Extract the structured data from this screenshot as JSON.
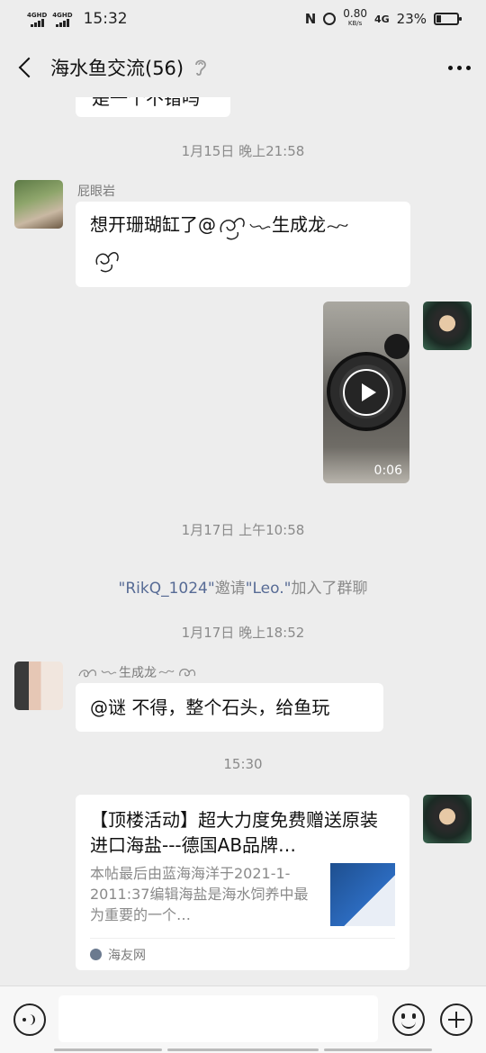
{
  "status_bar": {
    "signal1": "4GHD",
    "signal2": "4GHD",
    "time": "15:32",
    "nfc": "N",
    "speed_value": "0.80",
    "speed_unit": "KB/s",
    "network": "4G",
    "battery_percent": "23%",
    "battery_level": 0.23
  },
  "header": {
    "title": "海水鱼交流(56)"
  },
  "messages": {
    "partial_text": "是一个不错吗",
    "time1": "1月15日 晚上21:58",
    "msg1_nick": "屁眼岩",
    "msg1_text": "想开珊瑚缸了@",
    "msg1_mention": "生成龙",
    "video_duration": "0:06",
    "time2": "1月17日 上午10:58",
    "sys_name1": "\"RikQ_1024\"",
    "sys_invite": "邀请",
    "sys_name2": "\"Leo.\"",
    "sys_joined": "加入了群聊",
    "time3": "1月17日 晚上18:52",
    "msg2_nick": "生成龙",
    "msg2_text": "@谜  不得，整个石头，给鱼玩",
    "time4": "15:30",
    "card_title": "【顶楼活动】超大力度免费赠送原装进口海盐---德国AB品牌…",
    "card_desc": "本帖最后由蓝海海洋于2021-1-2011:37编辑海盐是海水饲养中最为重要的一个…",
    "card_source": "海友网"
  },
  "colors": {
    "background": "#ededed",
    "link": "#576b95",
    "bubble": "#ffffff"
  }
}
